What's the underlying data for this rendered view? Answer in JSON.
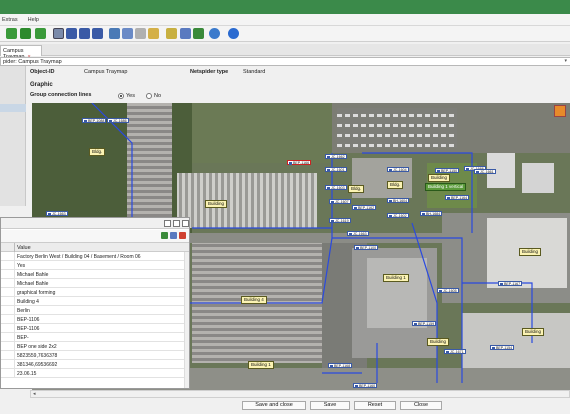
{
  "menu": {
    "items": [
      "Extras",
      "Help"
    ]
  },
  "tab": {
    "label": "Campus Traymap",
    "close": "×"
  },
  "breadcrumb": {
    "text": "pider: Campus Traymap"
  },
  "header": {
    "object_id_label": "Object-ID",
    "object_id_value": "Campus Traymap",
    "netspider_type_label": "Netspider type",
    "netspider_type_value": "Standard"
  },
  "section": {
    "title": "Graphic"
  },
  "group_connection": {
    "label": "Group connection lines",
    "yes": "Yes",
    "no": "No",
    "selected": "Yes"
  },
  "map": {
    "buildings": [
      "Bldg.",
      "Building",
      "Bldg.",
      "Bldg.",
      "Building",
      "Building 1 vertical",
      "Building",
      "Building 1",
      "Building",
      "Building 4",
      "Building",
      "Building 1"
    ],
    "tags": [
      "BEP-1088",
      "JC-1686",
      "BEP-1166",
      "JC-1662",
      "JC-1601",
      "JC-1603",
      "JC-1607",
      "JC-1619",
      "JC-1604",
      "JC-1602",
      "BEP-1162",
      "BEP-1150",
      "BEP-1164",
      "JC-1688",
      "BH-1684",
      "BH-1604",
      "JC-1663",
      "BEP-1100",
      "BEP-1167",
      "JC-1605",
      "JC-1671",
      "BEP-1154",
      "BEP-1168",
      "BEP-1160",
      "JC-1663",
      "JC-1661",
      "BEP-1159"
    ]
  },
  "panel": {
    "column_header": "Value",
    "rows": [
      "Factory Berlin West / Building 04 / Basement / Room 06",
      "Yes",
      "Michael Bahle",
      "Michael Bahle",
      "graphical forming",
      "Building 4",
      "Berlin",
      "BEP-1106",
      "BEP-1106",
      "BEP-",
      "BEP one side 2x2",
      "5823559,7636378",
      "381346,69536692",
      "23.06.15"
    ]
  },
  "buttons": {
    "save_close": "Save and close",
    "save": "Save",
    "reset": "Reset",
    "close": "Close"
  },
  "colors": {
    "titlebar": "#3b8a4a",
    "accent": "#3a5aa6",
    "building_label": "#fbf3b3"
  }
}
